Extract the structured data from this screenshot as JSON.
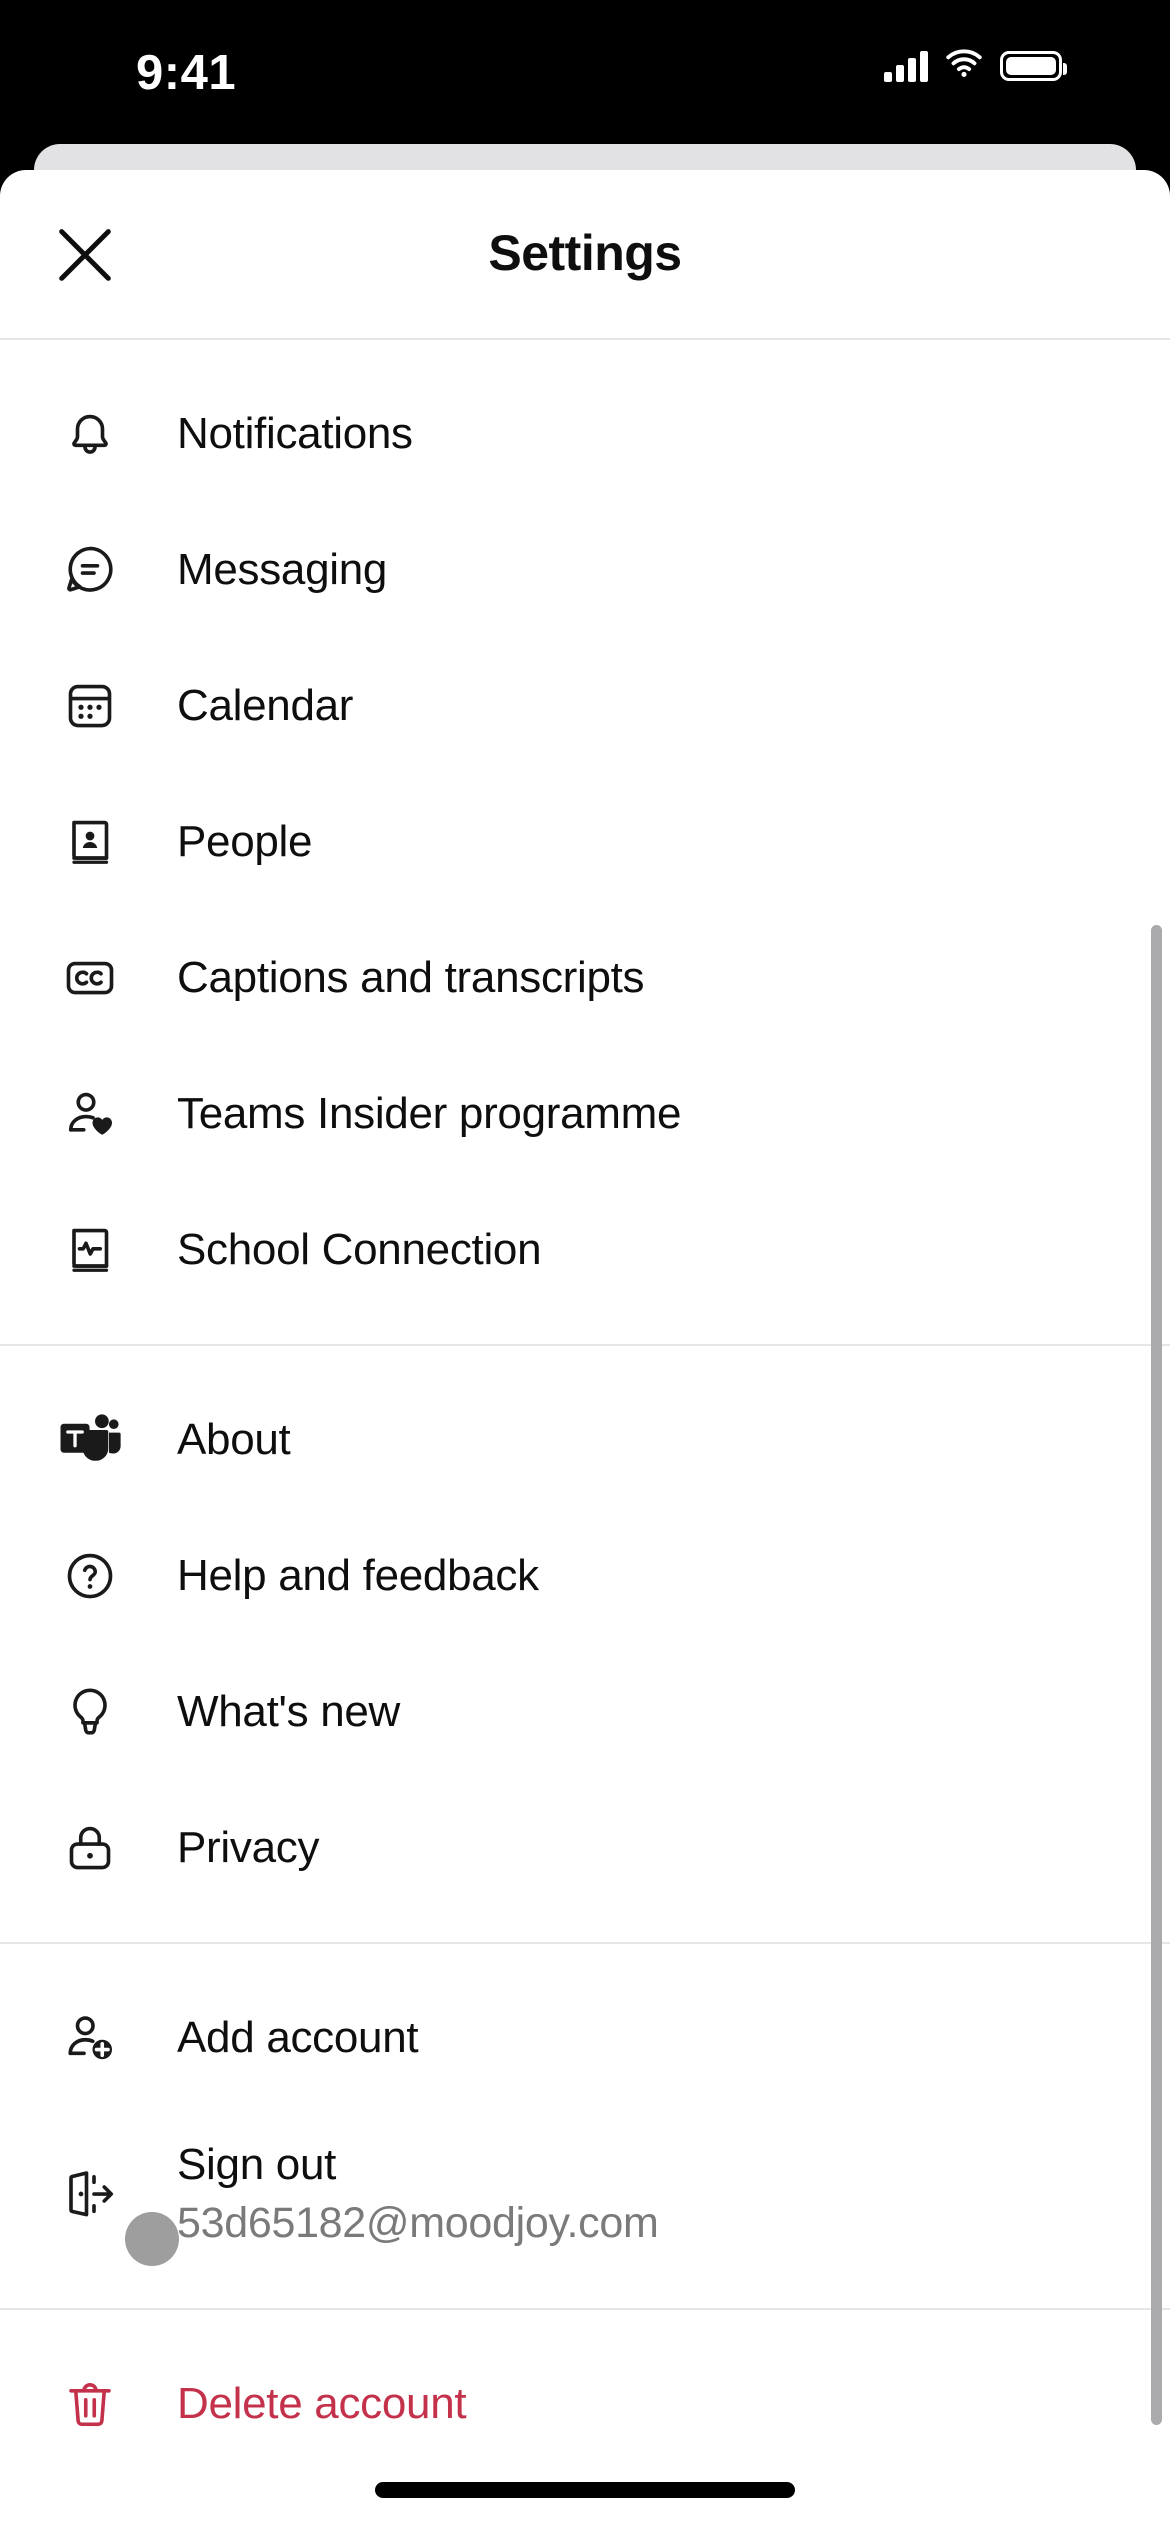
{
  "status_bar": {
    "time": "9:41",
    "icons": {
      "cellular": "signal-bars-icon",
      "wifi": "wifi-icon",
      "battery": "battery-icon"
    }
  },
  "header": {
    "title": "Settings",
    "close_icon": "close-icon"
  },
  "colors": {
    "danger": "#c4314b",
    "text": "#0e0e0e",
    "subtext": "#7a7a7a",
    "divider": "#e6e6e6",
    "sheet_bg": "#ffffff",
    "back_card": "#e2e1e4",
    "scrollbar": "#aaa9ab",
    "touch_dot": "#9e9e9e"
  },
  "sections": [
    {
      "name": "app-settings",
      "items": [
        {
          "label": "Notifications",
          "icon": "bell-icon"
        },
        {
          "label": "Messaging",
          "icon": "chat-bubble-icon"
        },
        {
          "label": "Calendar",
          "icon": "calendar-icon"
        },
        {
          "label": "People",
          "icon": "contact-book-icon"
        },
        {
          "label": "Captions and transcripts",
          "icon": "closed-caption-icon"
        },
        {
          "label": "Teams Insider programme",
          "icon": "person-heart-icon"
        },
        {
          "label": "School Connection",
          "icon": "book-pulse-icon"
        }
      ]
    },
    {
      "name": "info-section",
      "items": [
        {
          "label": "About",
          "icon": "teams-logo-icon"
        },
        {
          "label": "Help and feedback",
          "icon": "question-circle-icon"
        },
        {
          "label": "What's new",
          "icon": "lightbulb-icon"
        },
        {
          "label": "Privacy",
          "icon": "lock-icon"
        }
      ]
    },
    {
      "name": "account-section",
      "items": [
        {
          "label": "Add account",
          "icon": "person-add-icon"
        },
        {
          "label": "Sign out",
          "sub": "53d65182@moodjoy.com",
          "icon": "sign-out-icon"
        }
      ]
    },
    {
      "name": "danger-section",
      "items": [
        {
          "label": "Delete account",
          "icon": "trash-icon"
        }
      ]
    }
  ]
}
